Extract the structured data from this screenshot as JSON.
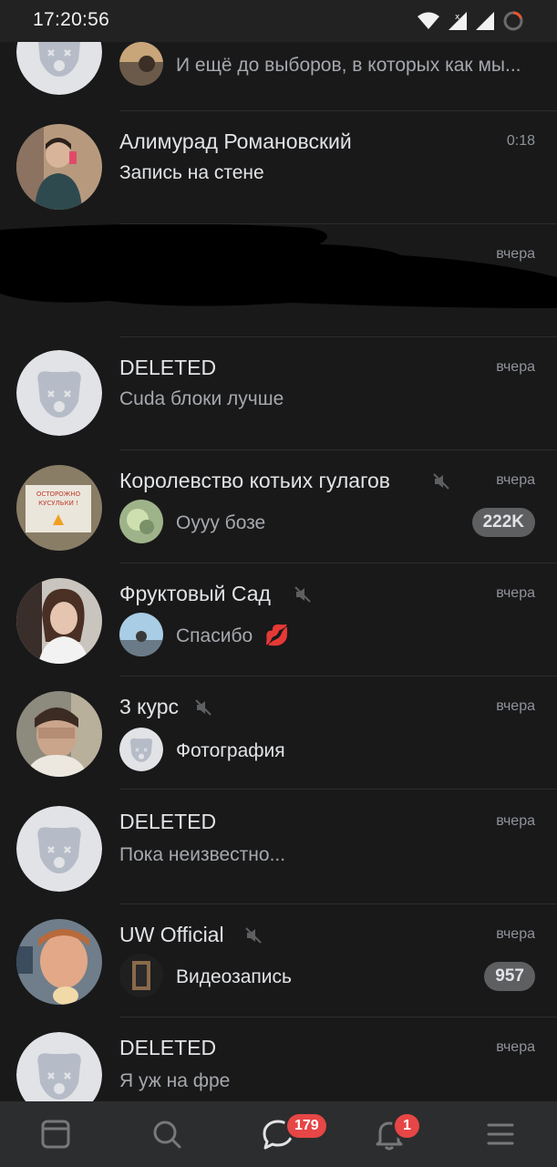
{
  "status_bar": {
    "time": "17:20:56"
  },
  "chats": [
    {
      "subtitle": "И ещё до выборов, в которых как мы..."
    },
    {
      "name": "Алимурад Романовский",
      "time": "0:18",
      "subtitle": "Запись на стене"
    },
    {
      "name": "",
      "time": "вчера",
      "subtitle": ""
    },
    {
      "name": "DELETED",
      "time": "вчера",
      "subtitle": "Cuda блоки лучше"
    },
    {
      "name": "Королевство котьих гулагов",
      "time": "вчера",
      "subtitle": "Оууу бозе",
      "unread": "222K",
      "avatar_text_1": "ОСТОРОЖНО",
      "avatar_text_2": "КУСУЛЬКИ !"
    },
    {
      "name": "Фруктовый Сад",
      "time": "вчера",
      "subtitle": "Спасибо",
      "emoji": "💋"
    },
    {
      "name": "3 курс",
      "time": "вчера",
      "subtitle": "Фотография"
    },
    {
      "name": "DELETED",
      "time": "вчера",
      "subtitle": "Пока неизвестно..."
    },
    {
      "name": "UW Official",
      "time": "вчера",
      "subtitle": "Видеозапись",
      "unread": "957"
    },
    {
      "name": "DELETED",
      "time": "вчера",
      "subtitle": "Я уж на фре"
    }
  ],
  "tabbar": {
    "messages_badge": "179",
    "notifications_badge": "1"
  },
  "colors": {
    "background": "#19191a",
    "tabbar": "#2c2d2e",
    "badge": "#e64646",
    "counter": "#5d5f61"
  }
}
